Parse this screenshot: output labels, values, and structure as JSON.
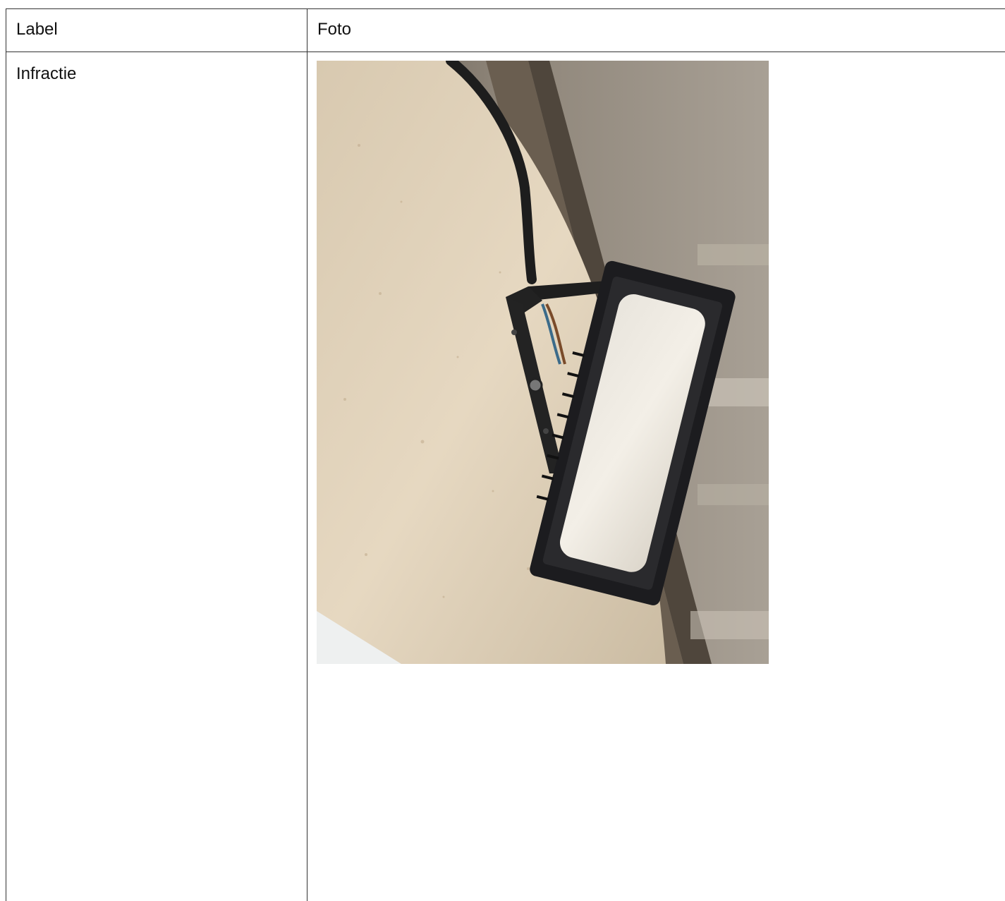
{
  "table": {
    "headers": [
      "Label",
      "Foto"
    ],
    "rows": [
      {
        "label": "Infractie",
        "photo_icon": "floodlight-photo"
      }
    ]
  }
}
